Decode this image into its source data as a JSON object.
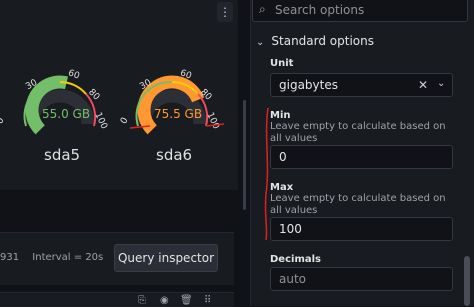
{
  "panel": {
    "menu_icon": "⋮"
  },
  "gauges": [
    {
      "name": "sda5",
      "value_text": "55.0 GB",
      "value": 55.0,
      "color": "#73bf69"
    },
    {
      "name": "sda6",
      "value_text": "75.5 GB",
      "value": 75.5,
      "color": "#ff9830"
    }
  ],
  "gauge_scale": {
    "min": 0,
    "max": 100,
    "ticks": [
      "0",
      "30",
      "60",
      "80",
      "100"
    ],
    "threshold_colors": [
      "#73bf69",
      "#f2cc0c",
      "#f2495c"
    ]
  },
  "query": {
    "info_prefix": "931",
    "interval": "Interval = 20s",
    "inspector_label": "Query inspector"
  },
  "options": {
    "search_placeholder": "Search options",
    "section_title": "Standard options",
    "unit": {
      "label": "Unit",
      "value": "gigabytes"
    },
    "min": {
      "label": "Min",
      "description": "Leave empty to calculate based on all values",
      "value": "0"
    },
    "max": {
      "label": "Max",
      "description": "Leave empty to calculate based on all values",
      "value": "100"
    },
    "decimals": {
      "label": "Decimals",
      "placeholder": "auto"
    }
  }
}
